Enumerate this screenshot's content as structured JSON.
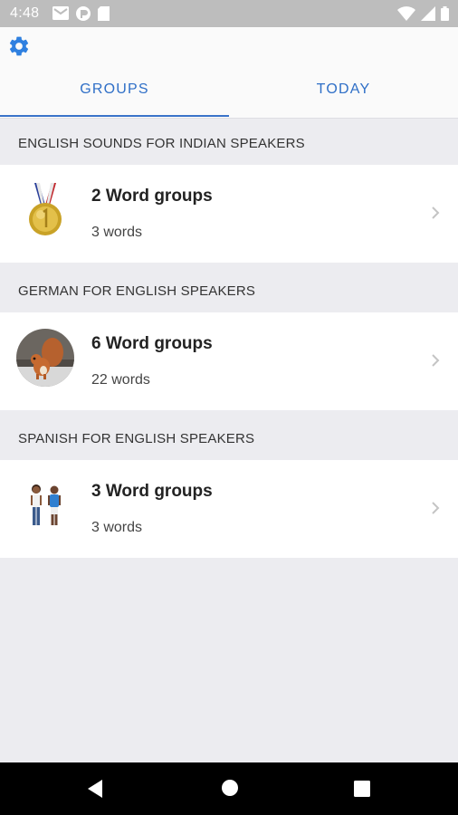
{
  "status_bar": {
    "time": "4:48"
  },
  "tabs": {
    "groups": "GROUPS",
    "today": "TODAY"
  },
  "sections": [
    {
      "title": "ENGLISH SOUNDS FOR INDIAN SPEAKERS",
      "card_title": "2 Word groups",
      "card_subtitle": "3 words",
      "image": "gold-medal"
    },
    {
      "title": "GERMAN FOR  ENGLISH SPEAKERS",
      "card_title": "6 Word groups",
      "card_subtitle": "22 words",
      "image": "squirrel-photo"
    },
    {
      "title": "SPANISH FOR  ENGLISH SPEAKERS",
      "card_title": "3 Word groups",
      "card_subtitle": "3 words",
      "image": "two-children"
    }
  ],
  "icons": {
    "settings": "gear-icon",
    "chevron": "chevron-right-icon",
    "nav": [
      "back-icon",
      "home-icon",
      "recents-icon"
    ]
  },
  "colors": {
    "accent": "#2f6fc7",
    "background": "#ececf0",
    "status_bar": "#bdbdbd"
  }
}
